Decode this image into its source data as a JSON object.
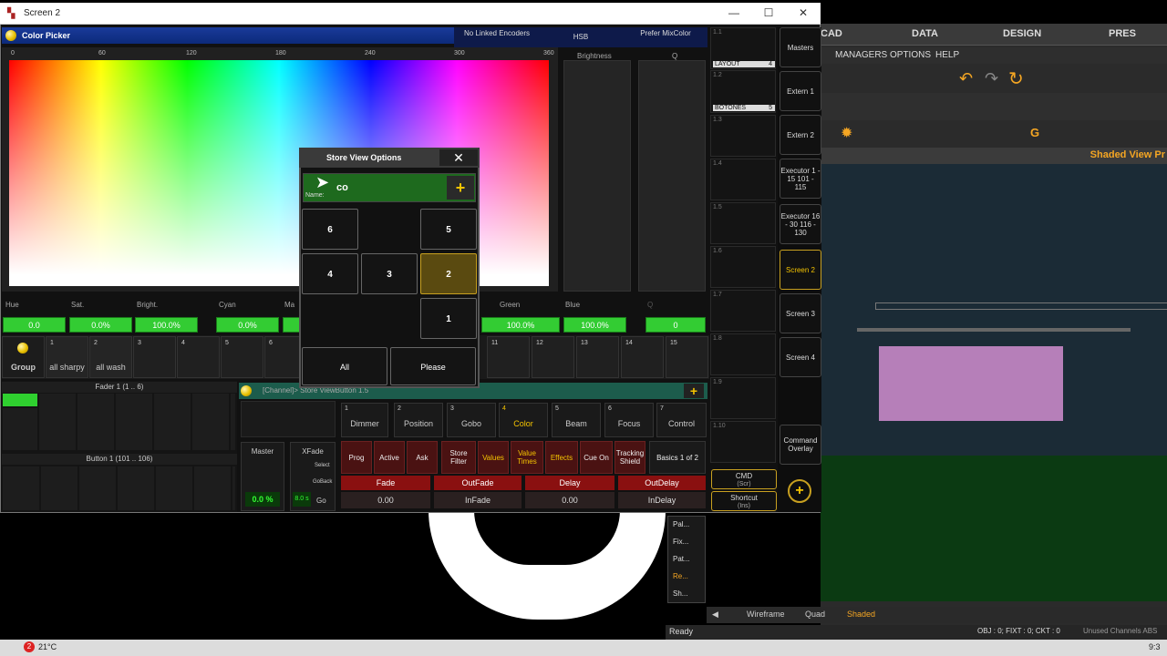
{
  "window": {
    "title": "Screen 2",
    "controls": [
      "—",
      "☐",
      "✕"
    ]
  },
  "bg_app": {
    "menus": [
      "CAD",
      "DATA",
      "DESIGN",
      "PRES"
    ],
    "submenus": [
      "MANAGERS",
      "OPTIONS",
      "HELP"
    ],
    "shaded_header": "Shaded View Pr",
    "bottom_tabs": [
      "Wireframe",
      "Quad",
      "Shaded"
    ],
    "status_left": "Ready",
    "status_right": "OBJ : 0; FIXT : 0; CKT : 0",
    "status_extra": "Unused Channels  ABS"
  },
  "taskbar": {
    "weather": "21°C",
    "badge": "2",
    "clock": "9:3"
  },
  "color_picker": {
    "title": "Color Picker",
    "encoders": [
      "No Linked Encoders",
      "HSB",
      "Prefer MixColor"
    ],
    "hue_ticks": [
      "0",
      "60",
      "120",
      "180",
      "240",
      "300",
      "360"
    ],
    "brightness_label": "Brightness",
    "q_label": "Q",
    "values": [
      {
        "label": "Hue",
        "value": "0.0"
      },
      {
        "label": "Sat.",
        "value": "0.0%"
      },
      {
        "label": "Bright.",
        "value": "100.0%"
      },
      {
        "label": "Cyan",
        "value": "0.0%"
      },
      {
        "label": "Ma",
        "value": ""
      },
      {
        "label": "Green",
        "value": "100.0%"
      },
      {
        "label": "Blue",
        "value": "100.0%"
      },
      {
        "label": "Q",
        "value": "0"
      }
    ]
  },
  "presets": {
    "group_label": "Group",
    "items": [
      {
        "num": "1",
        "label": "all sharpy"
      },
      {
        "num": "2",
        "label": "all wash"
      },
      {
        "num": "3",
        "label": ""
      },
      {
        "num": "4",
        "label": ""
      },
      {
        "num": "5",
        "label": ""
      },
      {
        "num": "6",
        "label": ""
      },
      {
        "num": "11",
        "label": ""
      },
      {
        "num": "12",
        "label": ""
      },
      {
        "num": "13",
        "label": ""
      },
      {
        "num": "14",
        "label": ""
      },
      {
        "num": "15",
        "label": ""
      }
    ]
  },
  "exec_col": {
    "layout_label": "LAYOUT",
    "layout_num": "4",
    "botones_label": "BOTONES",
    "botones_num": "5",
    "rows": [
      "1.3",
      "1.4",
      "1.5",
      "1.6",
      "1.7",
      "1.8",
      "1.9",
      "1.10"
    ],
    "cmd": "CMD",
    "cmd_sub": "(Scr)",
    "shortcut": "Shortcut",
    "shortcut_sub": "(Ins)"
  },
  "view_buttons": [
    "Masters",
    "Extern 1",
    "Extern 2",
    "Executor 1 - 15 101 - 115",
    "Executor 16 - 30 116 - 130",
    "Screen 2",
    "Screen 3",
    "Screen 4",
    "Command Overlay"
  ],
  "faders": {
    "fader_hdr": "Fader  1 (1 .. 6)",
    "button_hdr": "Button  1 (101 .. 106)",
    "master_label": "Master",
    "master_value": "0.0 %",
    "xfade_label": "XFade",
    "xfade_value": "8.0 s",
    "select": "Select",
    "goback": "GoBack",
    "go": "Go"
  },
  "channel": {
    "header": "[Channel]> Store ViewButton 1.5",
    "types": [
      {
        "num": "1",
        "label": "Dimmer"
      },
      {
        "num": "2",
        "label": "Position"
      },
      {
        "num": "3",
        "label": "Gobo"
      },
      {
        "num": "4",
        "label": "Color"
      },
      {
        "num": "5",
        "label": "Beam"
      },
      {
        "num": "6",
        "label": "Focus"
      },
      {
        "num": "7",
        "label": "Control"
      }
    ],
    "buttons": [
      "Prog",
      "Active",
      "Ask",
      "Store Filter",
      "Values",
      "Value Times",
      "Effects",
      "Cue On",
      "Tracking Shield",
      "Basics 1 of 2"
    ],
    "fade_hdrs": [
      "Fade",
      "OutFade",
      "Delay",
      "OutDelay"
    ],
    "fade_vals": [
      "0.00",
      "InFade",
      "0.00",
      "InDelay"
    ]
  },
  "dialog": {
    "title": "Store View Options",
    "name_label": "Name:",
    "name_value": "co",
    "buttons": [
      "6",
      "5",
      "4",
      "3",
      "2",
      "1",
      "All",
      "Please"
    ]
  },
  "side_panel": [
    "Pal...",
    "Fix...",
    "Pat...",
    "Re...",
    "Sh..."
  ]
}
